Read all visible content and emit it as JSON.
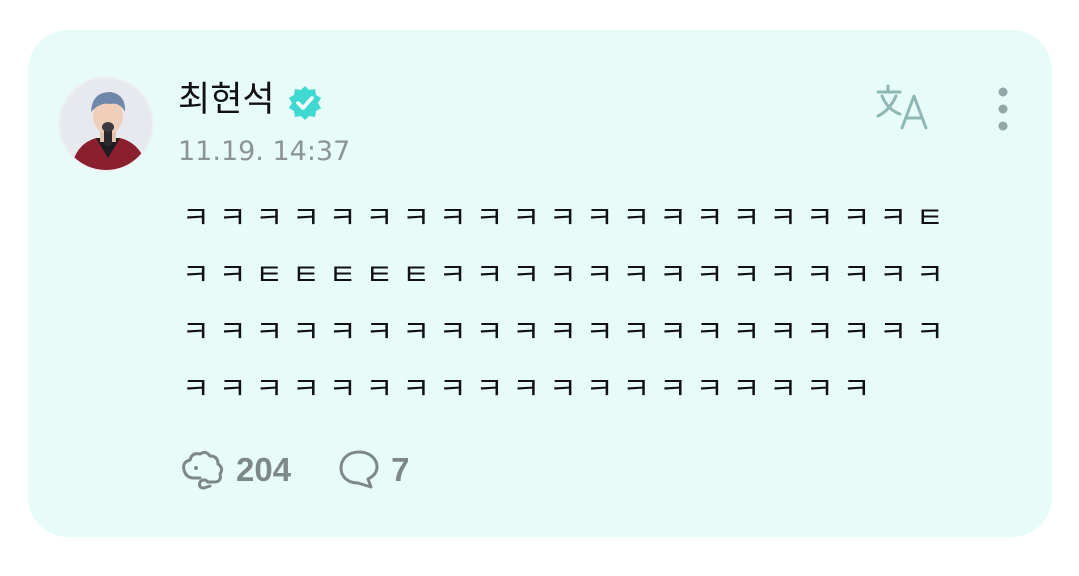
{
  "post": {
    "author": {
      "name": "최현석",
      "verified": true,
      "avatar_icon": "profile-photo"
    },
    "timestamp": "11.19. 14:37",
    "lines": [
      "ㅋㅋㅋㅋㅋㅋㅋㅋㅋㅋㅋㅋㅋㅋㅋㅋㅋㅋㅋㅋㅌ",
      "ㅋㅋㅌㅌㅌㅌㅌㅋㅋㅋㅋㅋㅋㅋㅋㅋㅋㅋㅋㅋㅋ",
      "ㅋㅋㅋㅋㅋㅋㅋㅋㅋㅋㅋㅋㅋㅋㅋㅋㅋㅋㅋㅋㅋ",
      "ㅋㅋㅋㅋㅋㅋㅋㅋㅋㅋㅋㅋㅋㅋㅋㅋㅋㅋㅋ"
    ],
    "reactions": {
      "like_count": "204",
      "comment_count": "7"
    }
  },
  "icons": {
    "verified": "verified-badge-icon",
    "translate": "translate-icon",
    "more": "more-vertical-icon",
    "like": "like-icon",
    "comment": "comment-bubble-icon"
  },
  "colors": {
    "card_background": "#e7fbf8",
    "accent": "#3fd9d2",
    "muted": "#8b9596"
  }
}
